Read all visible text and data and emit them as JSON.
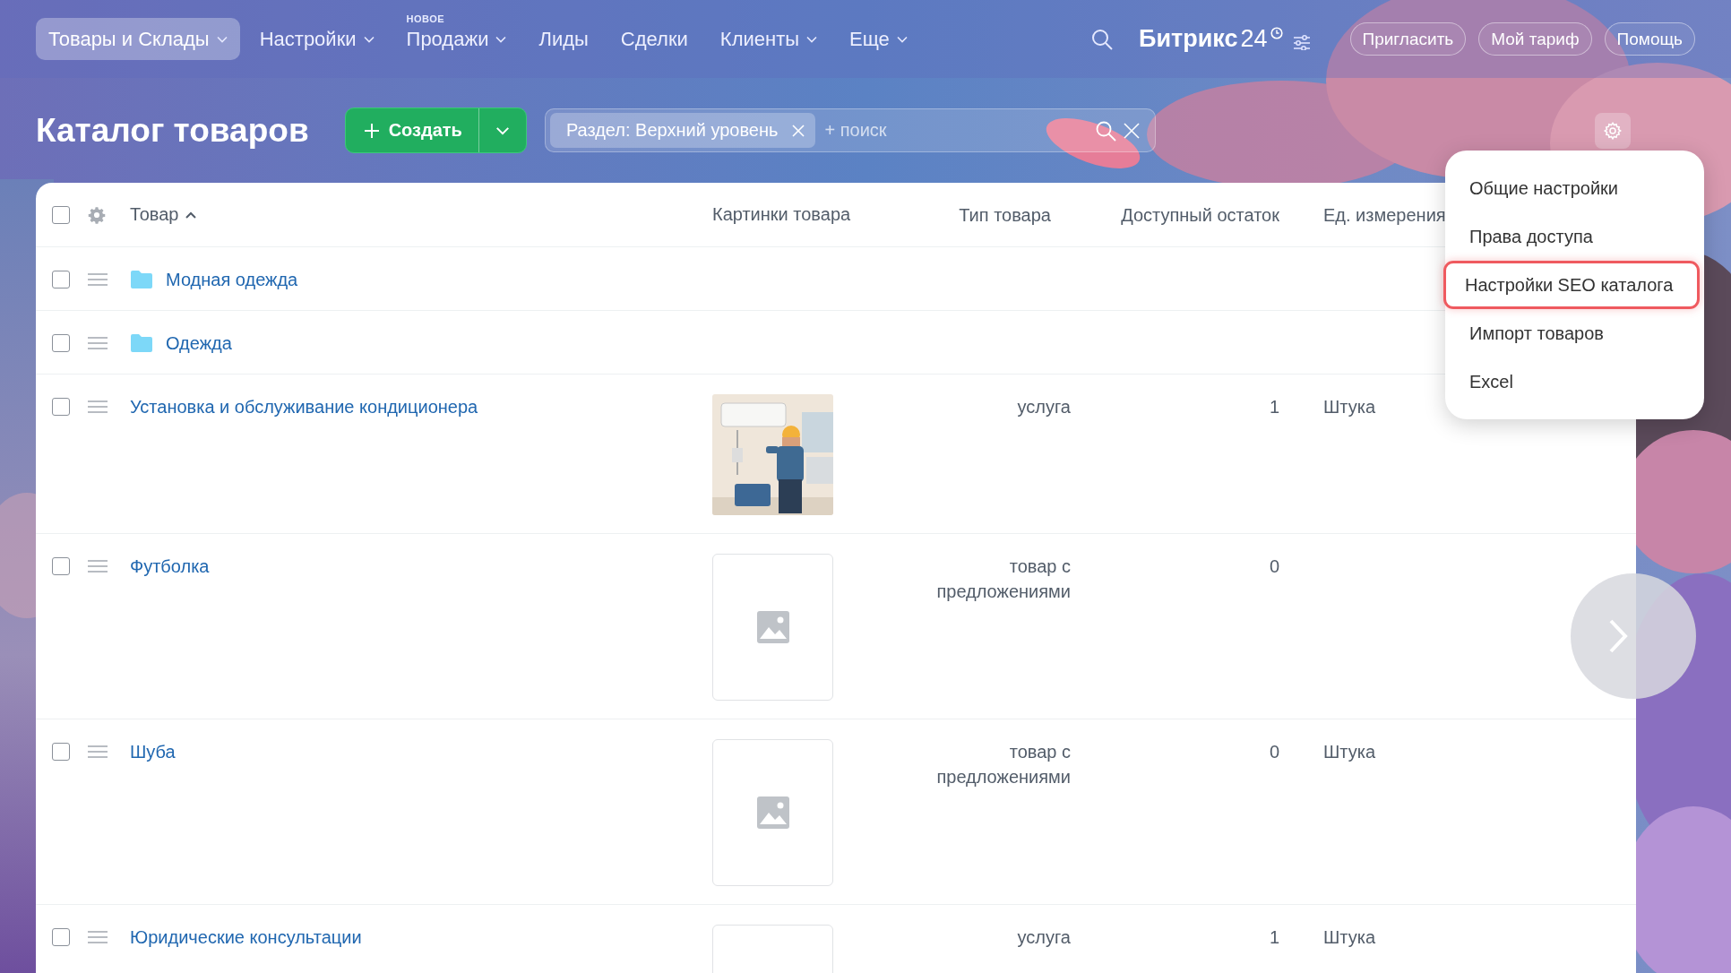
{
  "top_nav": {
    "items": [
      {
        "label": "Товары и Склады",
        "selected": true,
        "dropdown": true
      },
      {
        "label": "Настройки",
        "selected": false,
        "dropdown": true
      },
      {
        "label": "Продажи",
        "selected": false,
        "dropdown": true,
        "badge": "НОВОЕ"
      },
      {
        "label": "Лиды",
        "selected": false,
        "dropdown": false
      },
      {
        "label": "Сделки",
        "selected": false,
        "dropdown": false
      },
      {
        "label": "Клиенты",
        "selected": false,
        "dropdown": true
      },
      {
        "label": "Еще",
        "selected": false,
        "dropdown": true
      }
    ],
    "logo": {
      "text": "Битрикс",
      "number": "24"
    },
    "buttons": [
      "Пригласить",
      "Мой тариф",
      "Помощь"
    ]
  },
  "page": {
    "title": "Каталог товаров",
    "create_button": "Создать",
    "filter": {
      "tag": "Раздел: Верхний уровень",
      "placeholder": "+ поиск"
    }
  },
  "table": {
    "header_checked": false,
    "columns": [
      {
        "label": "Товар",
        "sort_ascending": true
      },
      {
        "label": "Картинки товара"
      },
      {
        "label": "Тип товара"
      },
      {
        "label": "Доступный остаток"
      },
      {
        "label": "Ед. измерения"
      }
    ],
    "rows": [
      {
        "kind": "folder",
        "name": "Модная одежда",
        "checked": false
      },
      {
        "kind": "folder",
        "name": "Одежда",
        "checked": false
      },
      {
        "kind": "product",
        "name": "Установка и обслуживание кондиционера",
        "checked": false,
        "photo": true,
        "type": "услуга",
        "stock": "1",
        "unit": "Штука"
      },
      {
        "kind": "product",
        "name": "Футболка",
        "checked": false,
        "photo": false,
        "type": "товар с предложениями",
        "stock": "0"
      },
      {
        "kind": "product",
        "name": "Шуба",
        "checked": false,
        "photo": false,
        "type": "товар с предложениями",
        "stock": "0",
        "unit": "Штука"
      },
      {
        "kind": "product",
        "name": "Юридические консультации",
        "checked": false,
        "photo": false,
        "type": "услуга",
        "stock": "1",
        "unit": "Штука"
      }
    ]
  },
  "settings_menu": {
    "items": [
      {
        "label": "Общие настройки",
        "highlighted": false
      },
      {
        "label": "Права доступа",
        "highlighted": false
      },
      {
        "label": "Настройки SEO каталога",
        "highlighted": true
      },
      {
        "label": "Импорт товаров",
        "highlighted": false
      },
      {
        "label": "Excel",
        "highlighted": false
      }
    ]
  }
}
